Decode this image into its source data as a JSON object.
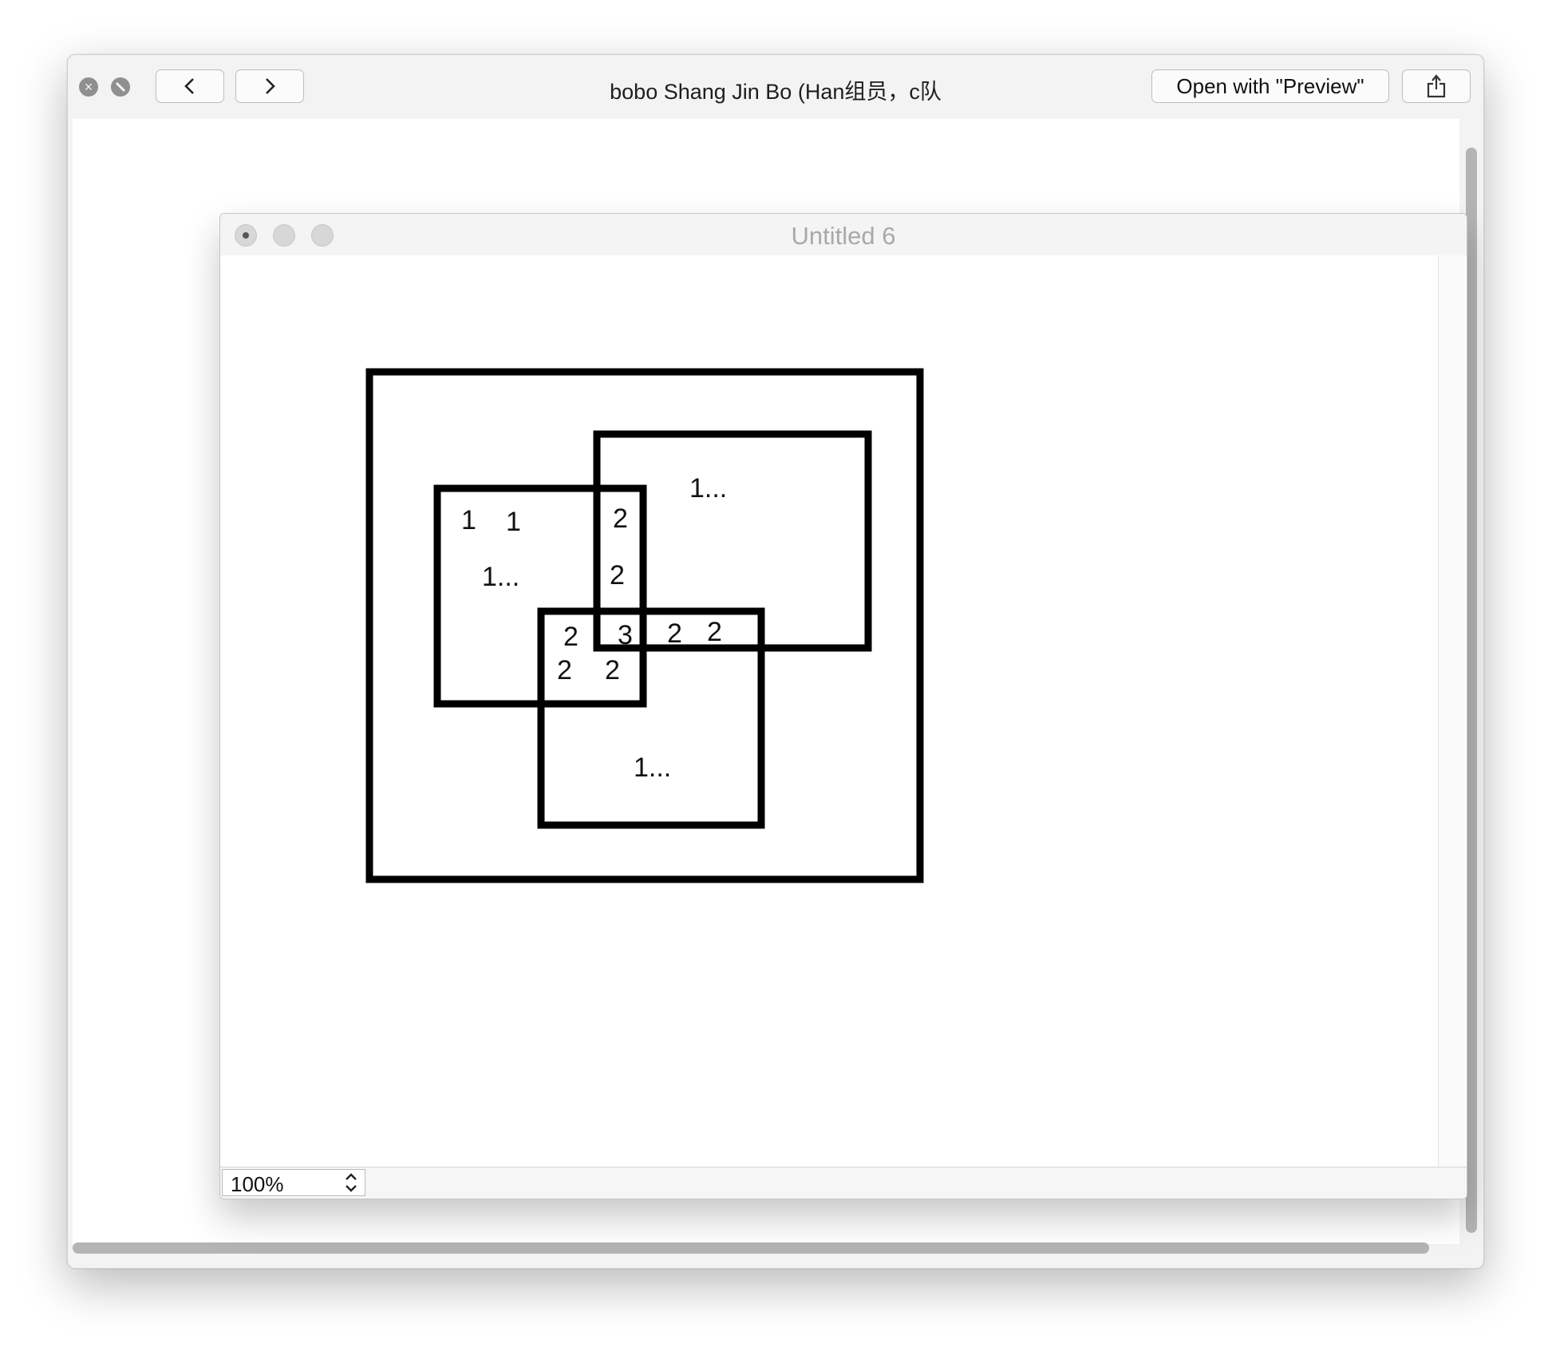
{
  "quicklook": {
    "title": "bobo Shang Jin Bo (Han组员，c队",
    "open_with_label": "Open with \"Preview\"",
    "icons": {
      "close": "close-icon",
      "fullscreen": "fullscreen-icon",
      "back": "chevron-left-icon",
      "forward": "chevron-right-icon",
      "share": "share-icon"
    }
  },
  "document": {
    "title": "Untitled 6",
    "zoom": "100%",
    "diagram": {
      "labels": [
        "1",
        "1",
        "1...",
        "2",
        "2",
        "1...",
        "2",
        "3",
        "2",
        "2",
        "2",
        "2",
        "1..."
      ]
    }
  }
}
